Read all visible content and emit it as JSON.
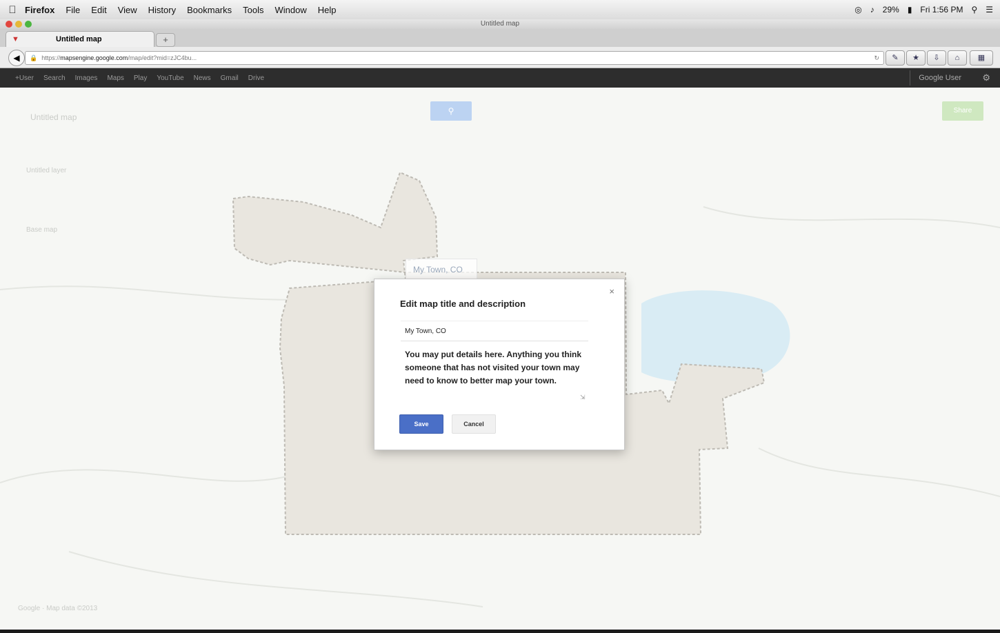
{
  "menubar": {
    "app": "Firefox",
    "items": [
      "File",
      "Edit",
      "View",
      "History",
      "Bookmarks",
      "Tools",
      "Window",
      "Help"
    ],
    "battery": "29%",
    "clock": "Fri 1:56 PM"
  },
  "window": {
    "title": "Untitled map",
    "tab_title": "Untitled map",
    "new_tab": "+",
    "url_scheme": "https://",
    "url_domain": "mapsengine.google.com",
    "url_path": "/map/edit?mid=zJC4bu..."
  },
  "google_bar": {
    "links": [
      "+User",
      "Search",
      "Images",
      "Maps",
      "Play",
      "YouTube",
      "News",
      "Gmail",
      "Drive"
    ],
    "user_button": "Google User"
  },
  "editor": {
    "map_title": "Untitled map",
    "layer_title": "Untitled layer",
    "base_map": "Base map",
    "search_icon": "search-icon",
    "share_button": "Share",
    "map_label": "My Town, CO",
    "footer_text": "Google · Map data ©2013"
  },
  "dialog": {
    "title": "Edit map title and description",
    "close": "×",
    "name_value": "My Town, CO",
    "description_value": "You may put details here. Anything you think someone that has not visited your town may need to know to better map your town.",
    "save_label": "Save",
    "cancel_label": "Cancel"
  },
  "colors": {
    "save_button": "#4a6fc7",
    "polygon_fill": "#e9e6df",
    "water": "#d9ecf4"
  }
}
